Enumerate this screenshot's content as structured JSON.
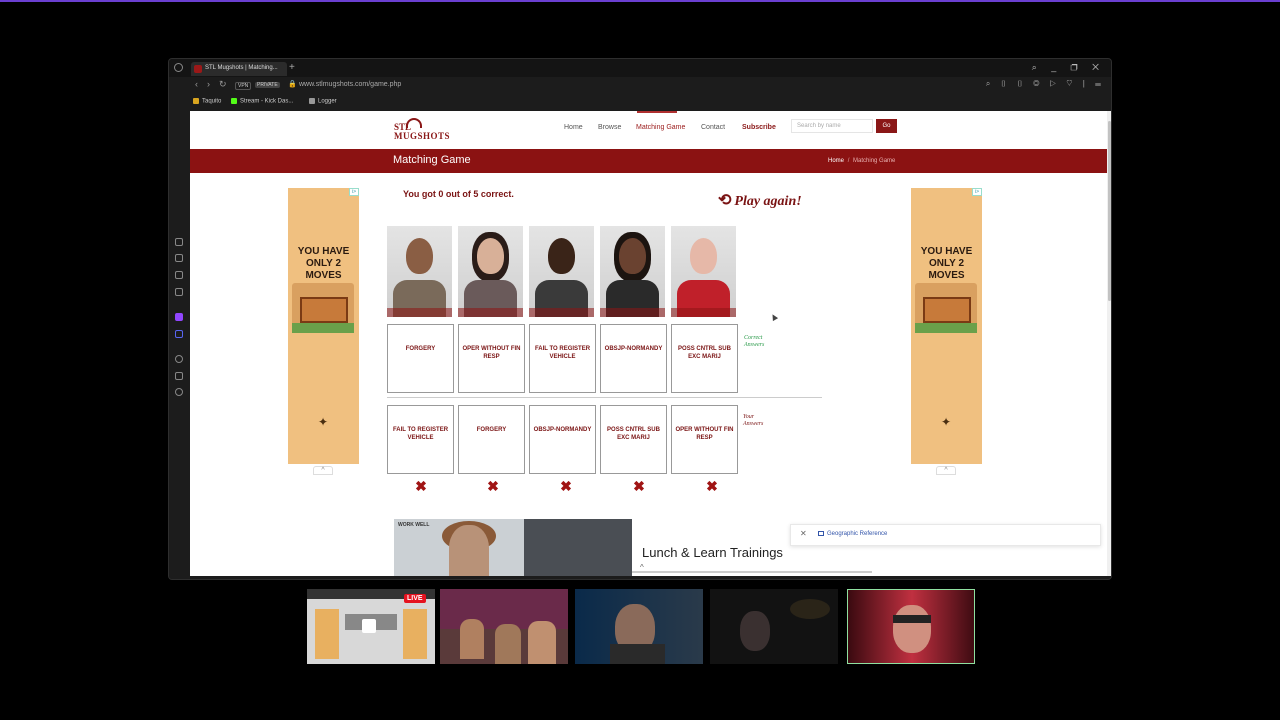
{
  "browser": {
    "tab_title": "STL Mugshots | Matching...",
    "url": "www.stlmugshots.com/game.php",
    "vpn_label": "VPN",
    "private_label": "PRIVATE",
    "bookmarks": [
      {
        "label": "Taquito",
        "color": "#d9a520"
      },
      {
        "label": "Stream - Kick Das...",
        "color": "#53fc18"
      },
      {
        "label": "Logger",
        "color": "#999999"
      }
    ]
  },
  "site": {
    "logo_line1": "STL",
    "logo_line2": "MUGSHOTS",
    "nav": [
      {
        "label": "Home"
      },
      {
        "label": "Browse"
      },
      {
        "label": "Matching Game"
      },
      {
        "label": "Contact"
      },
      {
        "label": "Subscribe"
      }
    ],
    "search_placeholder": "Search by name",
    "go_label": "Go",
    "banner_title": "Matching Game",
    "breadcrumb_home": "Home",
    "breadcrumb_sep": "/",
    "breadcrumb_current": "Matching Game",
    "brand_color": "#8b1212"
  },
  "ad": {
    "text": "YOU HAVE ONLY 2 MOVES",
    "badge": "i>"
  },
  "game": {
    "result_text": "You got 0 out of 5 correct.",
    "play_again": "Play again!",
    "correct_label": "Correct Answers",
    "your_label": "Your Answers",
    "correct_answers": [
      "FORGERY",
      "OPER WITHOUT FIN RESP",
      "FAIL TO REGISTER VEHICLE",
      "OBSJP-NORMANDY",
      "POSS CNTRL SUB EXC MARIJ"
    ],
    "your_answers": [
      "FAIL TO REGISTER VEHICLE",
      "FORGERY",
      "OBSJP-NORMANDY",
      "POSS CNTRL SUB EXC MARIJ",
      "OPER WITHOUT FIN RESP"
    ],
    "wrong_mark": "✖"
  },
  "bottom": {
    "ad_logo": "WORK WELL",
    "lunch_title": "Lunch & Learn Trainings",
    "geo_label": "Geographic Reference",
    "collapse_icon": "^"
  },
  "stream": {
    "live_label": "LIVE"
  }
}
